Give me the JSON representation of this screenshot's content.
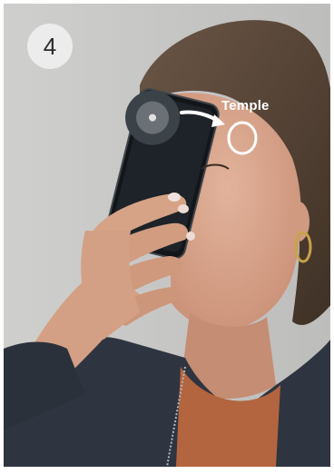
{
  "step": {
    "number": "4"
  },
  "annotation": {
    "label": "Temple",
    "arrow": "right-arrow-icon",
    "target": "circle-marker-icon"
  },
  "colors": {
    "background": "#c9c9c7",
    "hair": "#5a4636",
    "skin": "#d9a88f",
    "jacket": "#2f3540",
    "shirt": "#b3653f",
    "phone": "#121619",
    "annotation": "#ffffff"
  }
}
